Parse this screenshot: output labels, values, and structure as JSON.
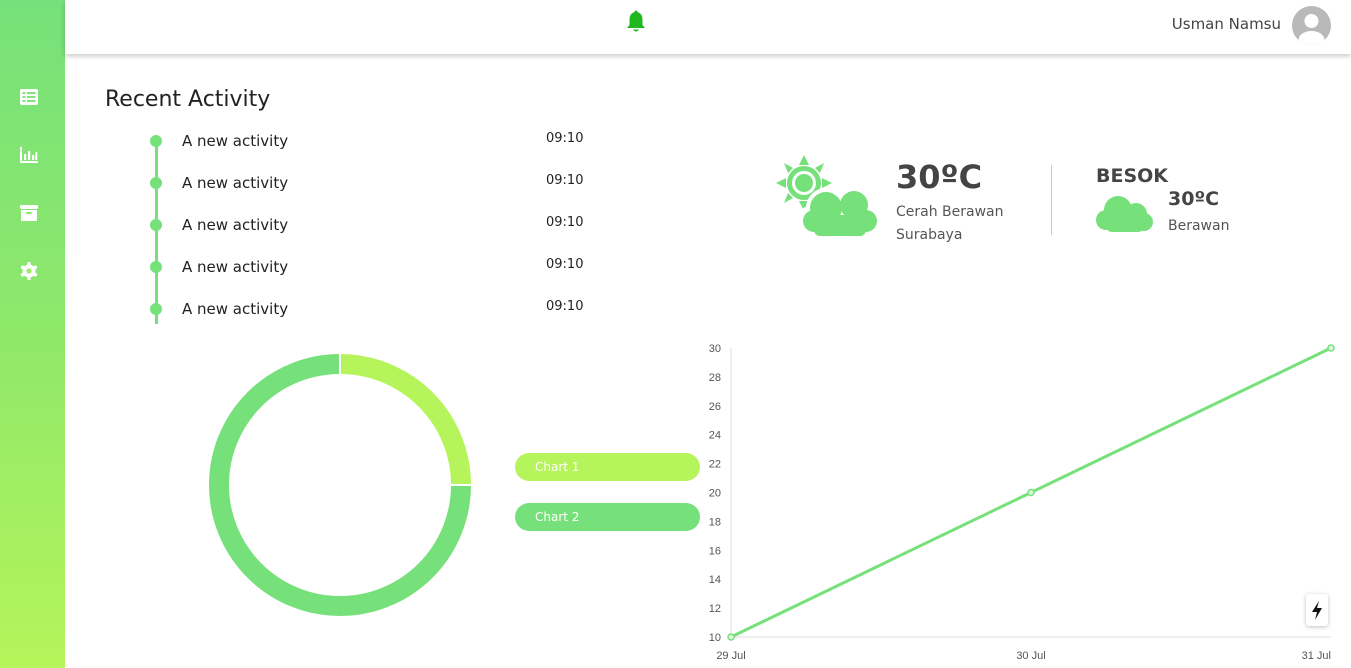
{
  "header": {
    "user_name": "Usman Namsu",
    "notification_icon": "bell-icon",
    "avatar_icon": "user-avatar-icon"
  },
  "sidebar": {
    "items": [
      {
        "icon": "list-icon"
      },
      {
        "icon": "bar-chart-icon"
      },
      {
        "icon": "archive-icon"
      },
      {
        "icon": "gear-icon"
      }
    ]
  },
  "recent_activity": {
    "title": "Recent Activity",
    "items": [
      {
        "text": "A new activity",
        "time": "09:10"
      },
      {
        "text": "A new activity",
        "time": "09:10"
      },
      {
        "text": "A new activity",
        "time": "09:10"
      },
      {
        "text": "A new activity",
        "time": "09:10"
      },
      {
        "text": "A new activity",
        "time": "09:10"
      }
    ]
  },
  "weather": {
    "today": {
      "temp": "30ºC",
      "condition": "Cerah Berawan",
      "city": "Surabaya",
      "icon": "partly-sunny-icon"
    },
    "tomorrow": {
      "label": "BESOK",
      "temp": "30ºC",
      "condition": "Berawan",
      "icon": "cloud-icon"
    }
  },
  "colors": {
    "primary": "#76e17a",
    "secondary": "#b5f45a"
  },
  "chart_data": [
    {
      "type": "pie",
      "categories": [
        "Chart 1",
        "Chart 2"
      ],
      "values": [
        25,
        75
      ],
      "colors": [
        "#b5f45a",
        "#76e17a"
      ],
      "legend_position": "right"
    },
    {
      "type": "line",
      "x": [
        "29 Jul",
        "30 Jul",
        "31 Jul"
      ],
      "series": [
        {
          "values": [
            10,
            20,
            30
          ],
          "color": "#76e17a"
        }
      ],
      "ylim": [
        10,
        30
      ],
      "yticks": [
        10,
        12,
        14,
        16,
        18,
        20,
        22,
        24,
        26,
        28,
        30
      ],
      "grid": false
    }
  ],
  "fab": {
    "icon": "lightning-icon"
  }
}
